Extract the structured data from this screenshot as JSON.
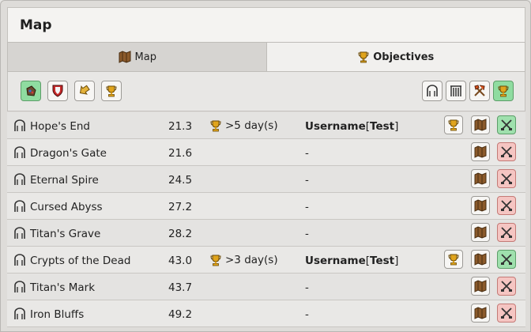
{
  "window": {
    "title": "Map"
  },
  "tabs": [
    {
      "label": "Map",
      "icon": "scroll-map-icon"
    },
    {
      "label": "Objectives",
      "icon": "trophy-icon"
    }
  ],
  "colors": {
    "accent_green": "#8fdca0",
    "accent_red": "#f5c5c2",
    "gold": "#e0a41c"
  },
  "toolbar": {
    "left": [
      "gem-bag-icon",
      "shield-icon",
      "arrow-sign-icon",
      "trophy-icon"
    ],
    "right": [
      "ruins-icon",
      "gate-icon",
      "hammer-pick-icon",
      "trophy-icon"
    ],
    "active_left": "gem-bag-icon",
    "active_right": "trophy-icon"
  },
  "rows": [
    {
      "name": "Hope's End",
      "value": "21.3",
      "objective": ">5 day(s)",
      "owner_user": "Username",
      "owner_tag": "Test",
      "has_trophy": true,
      "status": "green"
    },
    {
      "name": "Dragon's Gate",
      "value": "21.6",
      "objective": "",
      "owner": "-",
      "has_trophy": false,
      "status": "red"
    },
    {
      "name": "Eternal Spire",
      "value": "24.5",
      "objective": "",
      "owner": "-",
      "has_trophy": false,
      "status": "red"
    },
    {
      "name": "Cursed Abyss",
      "value": "27.2",
      "objective": "",
      "owner": "-",
      "has_trophy": false,
      "status": "red"
    },
    {
      "name": "Titan's Grave",
      "value": "28.2",
      "objective": "",
      "owner": "-",
      "has_trophy": false,
      "status": "red"
    },
    {
      "name": "Crypts of the Dead",
      "value": "43.0",
      "objective": ">3 day(s)",
      "owner_user": "Username",
      "owner_tag": "Test",
      "has_trophy": true,
      "status": "green"
    },
    {
      "name": "Titan's Mark",
      "value": "43.7",
      "objective": "",
      "owner": "-",
      "has_trophy": false,
      "status": "red"
    },
    {
      "name": "Iron Bluffs",
      "value": "49.2",
      "objective": "",
      "owner": "-",
      "has_trophy": false,
      "status": "red"
    }
  ]
}
